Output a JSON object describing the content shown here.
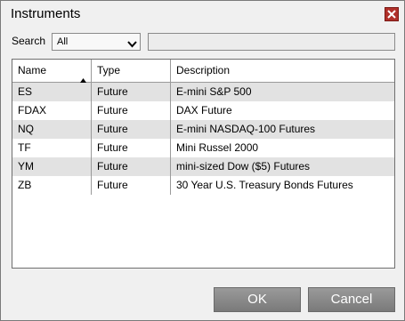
{
  "window": {
    "title": "Instruments"
  },
  "search": {
    "label": "Search",
    "selected": "All",
    "query": ""
  },
  "table": {
    "columns": [
      "Name",
      "Type",
      "Description"
    ],
    "rows": [
      {
        "name": "ES",
        "type": "Future",
        "description": "E-mini S&P 500"
      },
      {
        "name": "FDAX",
        "type": "Future",
        "description": "DAX Future"
      },
      {
        "name": "NQ",
        "type": "Future",
        "description": "E-mini NASDAQ-100 Futures"
      },
      {
        "name": "TF",
        "type": "Future",
        "description": "Mini Russel 2000"
      },
      {
        "name": "YM",
        "type": "Future",
        "description": "mini-sized Dow ($5) Futures"
      },
      {
        "name": "ZB",
        "type": "Future",
        "description": "30 Year U.S. Treasury Bonds Futures"
      }
    ]
  },
  "buttons": {
    "ok": "OK",
    "cancel": "Cancel"
  },
  "colors": {
    "accent": "#b0302a",
    "row_alt": "#e2e2e2",
    "button": "#8a8a8a"
  }
}
